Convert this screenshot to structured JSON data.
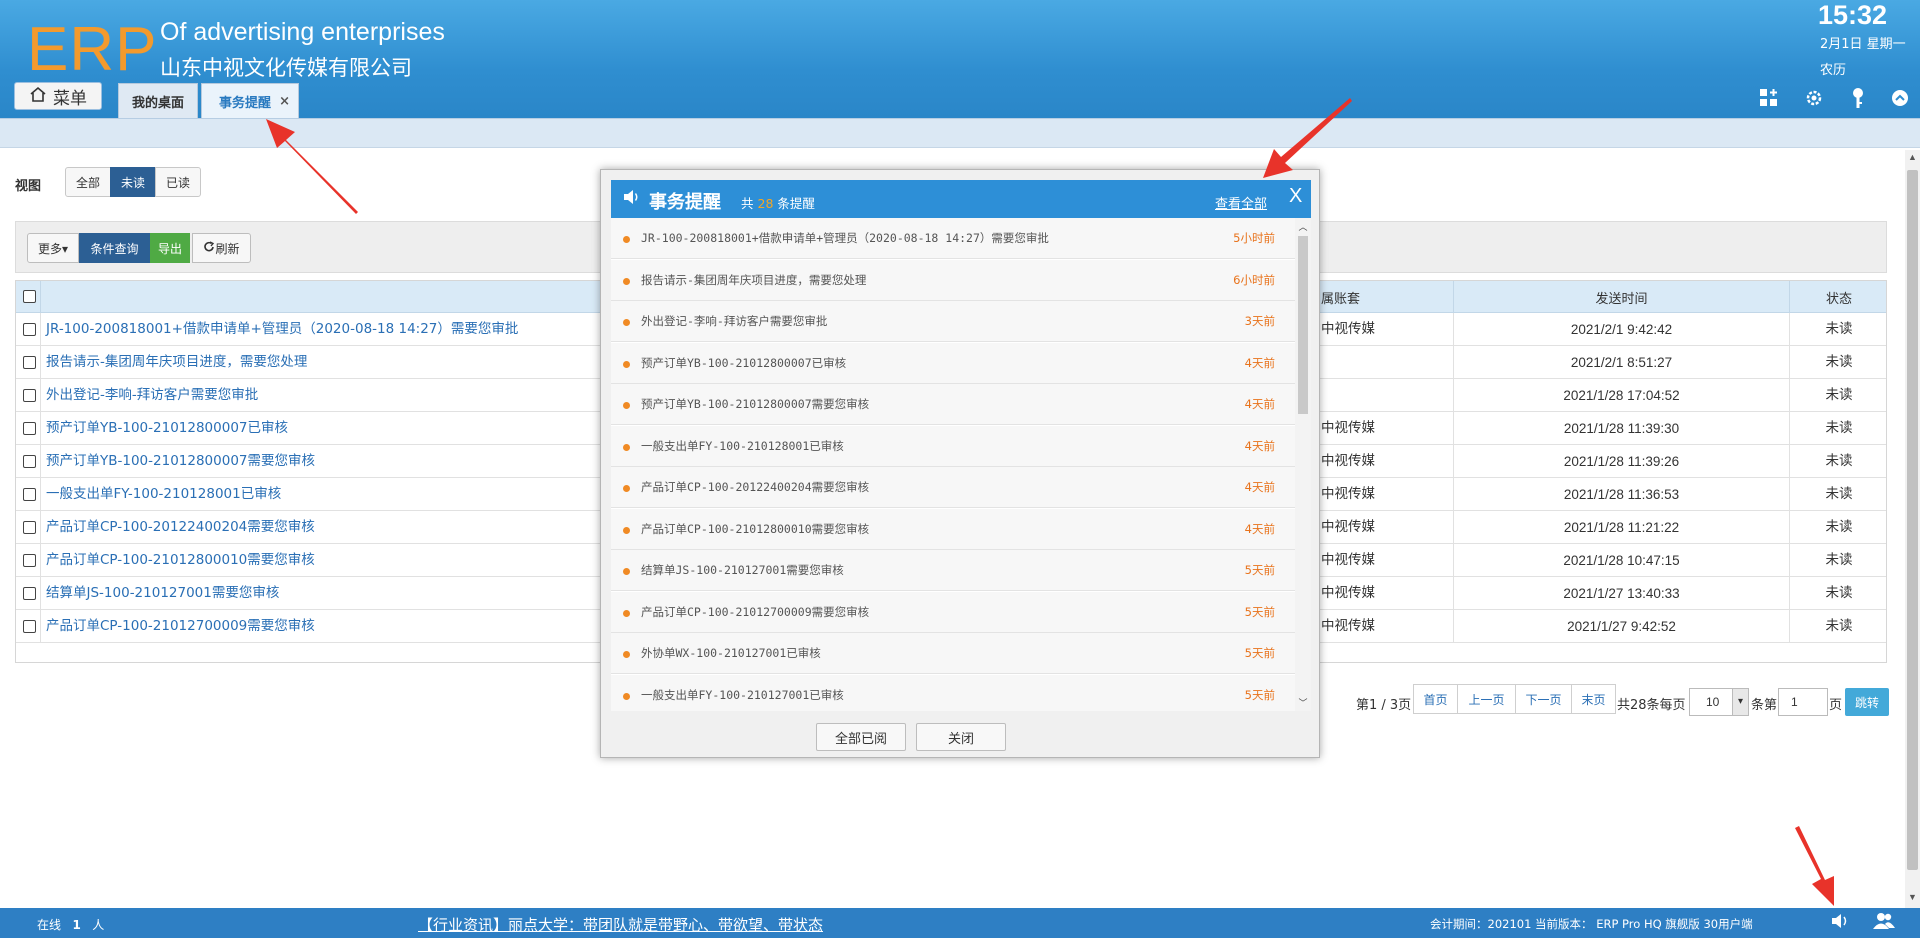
{
  "header": {
    "logo": "ERP",
    "company_en": "Of advertising enterprises",
    "company_cn": "山东中视文化传媒有限公司",
    "clock": "15:32",
    "date": "2月1日 星期一",
    "lunar": "农历",
    "menu_label": "菜单",
    "tabs": [
      {
        "label": "我的桌面"
      },
      {
        "label": "事务提醒"
      }
    ],
    "icons": [
      "apps-icon",
      "gear-icon",
      "key-icon",
      "collapse-up-icon"
    ]
  },
  "view": {
    "label": "视图",
    "options": [
      "全部",
      "未读",
      "已读"
    ],
    "selected": "未读"
  },
  "toolbar": {
    "more": "更多▾",
    "query": "条件查询",
    "export": "导出",
    "refresh": "刷新"
  },
  "table": {
    "columns": [
      "",
      "属账套",
      "发送时间",
      "状态"
    ],
    "rows": [
      {
        "title": "JR-100-200818001+借款申请单+管理员（2020-08-18 14:27）需要您审批",
        "account": "中视传媒",
        "time": "2021/2/1 9:42:42",
        "status": "未读"
      },
      {
        "title": "报告请示-集团周年庆项目进度，需要您处理",
        "account": "",
        "time": "2021/2/1 8:51:27",
        "status": "未读"
      },
      {
        "title": "外出登记-李响-拜访客户需要您审批",
        "account": "",
        "time": "2021/1/28 17:04:52",
        "status": "未读"
      },
      {
        "title": "预产订单YB-100-21012800007已审核",
        "account": "中视传媒",
        "time": "2021/1/28 11:39:30",
        "status": "未读"
      },
      {
        "title": "预产订单YB-100-21012800007需要您审核",
        "account": "中视传媒",
        "time": "2021/1/28 11:39:26",
        "status": "未读"
      },
      {
        "title": "一般支出单FY-100-210128001已审核",
        "account": "中视传媒",
        "time": "2021/1/28 11:36:53",
        "status": "未读"
      },
      {
        "title": "产品订单CP-100-20122400204需要您审核",
        "account": "中视传媒",
        "time": "2021/1/28 11:21:22",
        "status": "未读"
      },
      {
        "title": "产品订单CP-100-21012800010需要您审核",
        "account": "中视传媒",
        "time": "2021/1/28 10:47:15",
        "status": "未读"
      },
      {
        "title": "结算单JS-100-210127001需要您审核",
        "account": "中视传媒",
        "time": "2021/1/27 13:40:33",
        "status": "未读"
      },
      {
        "title": "产品订单CP-100-21012700009需要您审核",
        "account": "中视传媒",
        "time": "2021/1/27 9:42:52",
        "status": "未读"
      }
    ]
  },
  "pagination": {
    "page_info": "第1 / 3页",
    "first": "首页",
    "prev": "上一页",
    "next": "下一页",
    "last": "末页",
    "total": "共28条每页",
    "per_page": "10",
    "goto_prefix": "条第",
    "goto_value": "1",
    "goto_suffix": "页",
    "jump": "跳转"
  },
  "modal": {
    "title": "事务提醒",
    "count_prefix": "共",
    "count": "28",
    "count_suffix": "条提醒",
    "view_all": "查看全部",
    "close_x": "X",
    "items": [
      {
        "text": "JR-100-200818001+借款申请单+管理员（2020-08-18 14:27）需要您审批",
        "ago": "5小时前"
      },
      {
        "text": "报告请示-集团周年庆项目进度，需要您处理",
        "ago": "6小时前"
      },
      {
        "text": "外出登记-李响-拜访客户需要您审批",
        "ago": "3天前"
      },
      {
        "text": "预产订单YB-100-21012800007已审核",
        "ago": "4天前"
      },
      {
        "text": "预产订单YB-100-21012800007需要您审核",
        "ago": "4天前"
      },
      {
        "text": "一般支出单FY-100-210128001已审核",
        "ago": "4天前"
      },
      {
        "text": "产品订单CP-100-20122400204需要您审核",
        "ago": "4天前"
      },
      {
        "text": "产品订单CP-100-21012800010需要您审核",
        "ago": "4天前"
      },
      {
        "text": "结算单JS-100-210127001需要您审核",
        "ago": "5天前"
      },
      {
        "text": "产品订单CP-100-21012700009需要您审核",
        "ago": "5天前"
      },
      {
        "text": "外协单WX-100-210127001已审核",
        "ago": "5天前"
      },
      {
        "text": "一般支出单FY-100-210127001已审核",
        "ago": "5天前"
      }
    ],
    "mark_all_read": "全部已阅",
    "close": "关闭"
  },
  "footer": {
    "online_label": "在线",
    "online_count": "1",
    "online_unit": "人",
    "news": "【行业资讯】丽点大学：带团队就是带野心、带欲望、带状态",
    "version": "会计期间：202101 当前版本： ERP Pro HQ 旗舰版 30用户端"
  },
  "colors": {
    "header_blue": "#2f8ed0",
    "logo_orange": "#f39a2d",
    "link_blue": "#2a6fb5",
    "selected_dark_blue": "#2c5f94",
    "export_green": "#4faa44",
    "ago_orange": "#e8731c",
    "arrow_red": "#e8332a"
  }
}
